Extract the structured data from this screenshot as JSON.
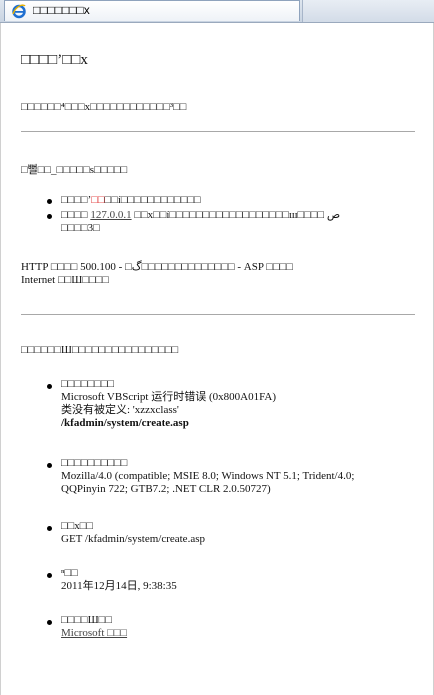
{
  "browser": {
    "tab_title": "□□□□□□□x"
  },
  "page": {
    "title": "□□□□’□□x",
    "subtitle": "□□□□□□⁴□□□x□□□□□□□□□□□□³□□",
    "section1_heading": "□뻘□□_□□□□□s□□□□□",
    "bullet1": {
      "prefix": "□□□□’",
      "red": "□□",
      "suffix": "□□í□□□□□□□□□□□□"
    },
    "bullet2": {
      "prefix": "□□□□ ",
      "link": "127.0.0.1",
      "suffix": " □□x□□í□□□□□□□□□□□□□□□□□□ш□□□□ ص",
      "line2": "□□□□3□"
    },
    "error_line1": "HTTP □□□□ 500.100 - □گ□□□□□□□□□□□□□□ - ASP □□□□",
    "error_line2": "Internet □□Ш□□□□",
    "section2_heading": "□□□□□□Ш□□□□□□□□□□□□□□□□",
    "details": [
      {
        "label": "□□□□□□□□",
        "lines": [
          "Microsoft VBScript 运行时错误  (0x800A01FA)",
          "类没有被定义: 'xzzxclass'"
        ],
        "bold_line": "/kfadmin/system/create.asp"
      },
      {
        "label": "□□□□□□□□□□",
        "lines": [
          "Mozilla/4.0 (compatible; MSIE 8.0; Windows NT 5.1; Trident/4.0;",
          "QQPinyin 722; GTB7.2; .NET CLR 2.0.50727)"
        ],
        "bold_line": ""
      },
      {
        "label": "□□x□□",
        "lines": [
          "GET /kfadmin/system/create.asp"
        ],
        "bold_line": ""
      },
      {
        "label": "ⁿ□□",
        "lines": [
          "2011年12月14日, 9:38:35"
        ],
        "bold_line": ""
      },
      {
        "label": "□□□□Ш□□",
        "link": "Microsoft □□□"
      }
    ]
  },
  "colors": {
    "link_red": "#d22",
    "rule": "#a8a8a8",
    "ie_blue": "#1f6fd0"
  },
  "icons": {
    "browser_icon": "ie-logo-icon"
  }
}
